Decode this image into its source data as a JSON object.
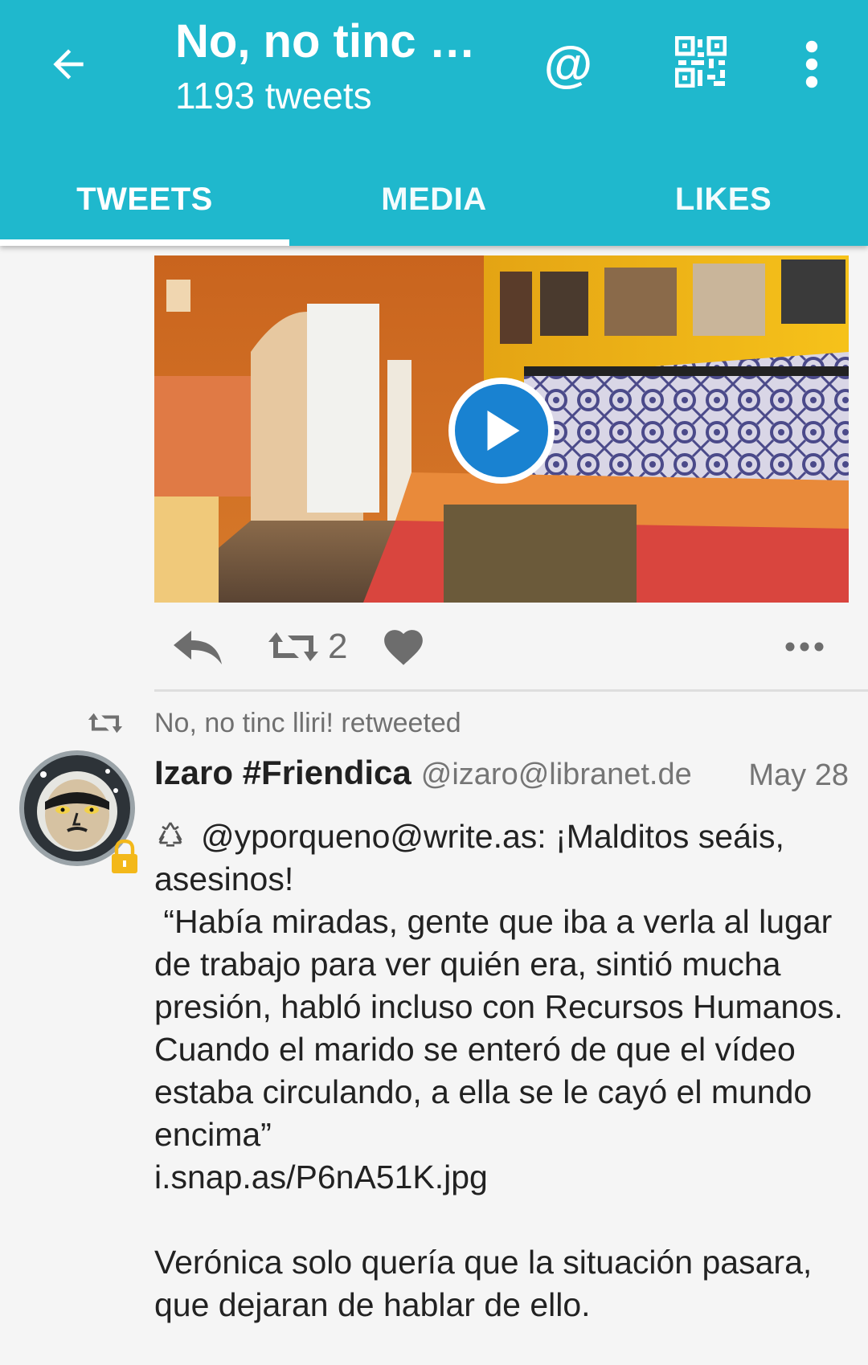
{
  "appbar": {
    "title": "No, no tinc ll…",
    "subtitle": "1193 tweets",
    "mention_icon": "at-icon",
    "qr_icon": "qr-code-icon",
    "menu_icon": "more-vert-icon",
    "back_icon": "arrow-back-icon",
    "color": "#1fb8cd"
  },
  "tabs": [
    {
      "label": "TWEETS",
      "active": true
    },
    {
      "label": "MEDIA",
      "active": false
    },
    {
      "label": "LIKES",
      "active": false
    }
  ],
  "previous_tweet": {
    "media_type": "video",
    "play_icon": "play-icon",
    "retweet_count": "2"
  },
  "retweet_notice": {
    "text": "No, no tinc lliri! retweeted"
  },
  "tweet": {
    "author_name": "Izaro #Friendica",
    "author_handle": "@izaro@libranet.de",
    "date": "May 28",
    "lines": [
      "@yporqueno@write.as:  ¡Malditos seáis, asesinos!",
      " “Había miradas, gente que iba a verla al lugar de trabajo para ver quién era, sintió mucha presión, habló incluso con Recursos Humanos. Cuando el marido se enteró de que el vídeo estaba circulando, a ella se le cayó el mundo encima”",
      "i.snap.as/P6nA51K.jpg",
      "Verónica solo quería que la situación pasara, que dejaran de hablar de ello."
    ]
  }
}
